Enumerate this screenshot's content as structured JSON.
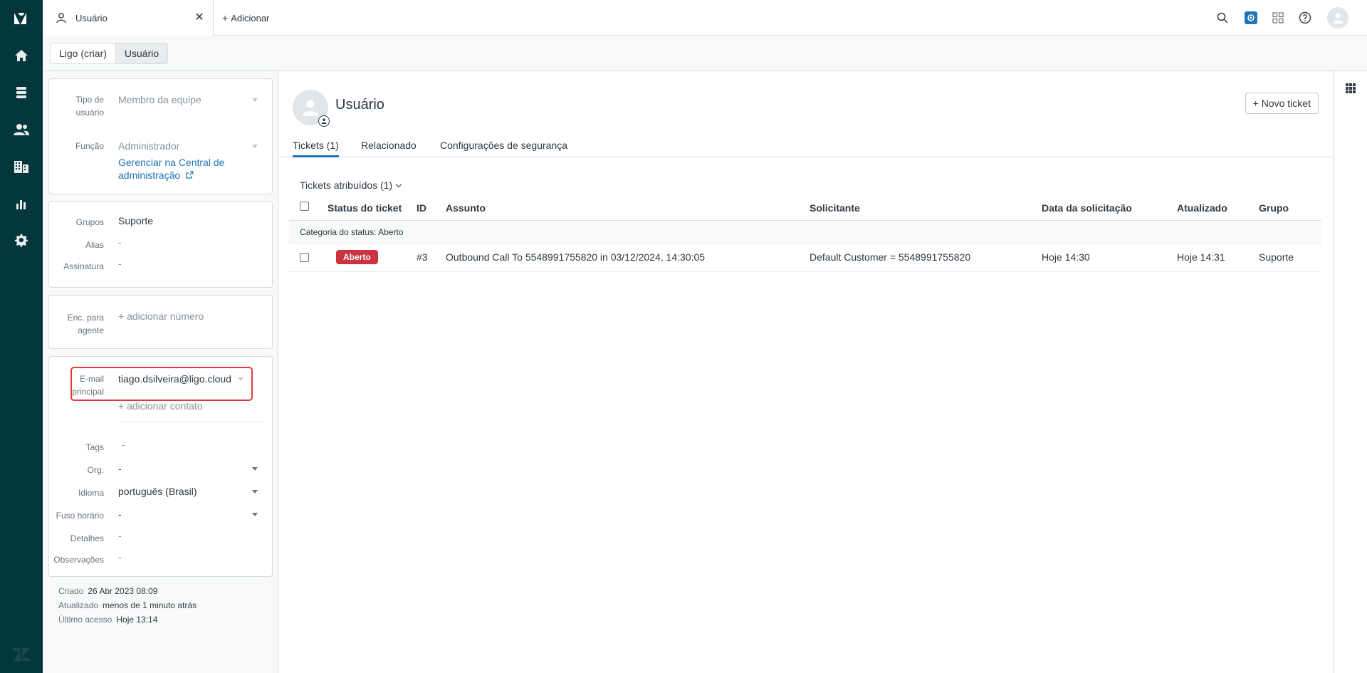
{
  "nav": {
    "items": [
      {
        "name": "home-icon"
      },
      {
        "name": "views-icon"
      },
      {
        "name": "customers-icon"
      },
      {
        "name": "organizations-icon"
      },
      {
        "name": "reporting-icon"
      },
      {
        "name": "admin-gear-icon"
      }
    ]
  },
  "topbar": {
    "tab_title": "Usuário",
    "add_label": "Adicionar",
    "add_plus": "+"
  },
  "breadcrumb": {
    "items": [
      "Ligo (criar)",
      "Usuário"
    ]
  },
  "user_card": {
    "type_label": "Tipo de usuário",
    "type_value": "Membro da equipe",
    "role_label": "Função",
    "role_value": "Administrador",
    "role_link": "Gerenciar na Central de administração"
  },
  "groups_card": {
    "groups_label": "Grupos",
    "groups_value": "Suporte",
    "alias_label": "Alias",
    "alias_value": "-",
    "signature_label": "Assinatura",
    "signature_value": "-"
  },
  "forward_card": {
    "label": "Enc. para agente",
    "add_number": "+ adicionar número"
  },
  "contact_card": {
    "email_label": "E-mail principal",
    "email_value": "tiago.dsilveira@ligo.cloud",
    "add_contact": "+ adicionar contato",
    "tags_label": "Tags",
    "tags_value": "-",
    "org_label": "Org.",
    "org_value": "-",
    "language_label": "Idioma",
    "language_value": "português (Brasil)",
    "timezone_label": "Fuso horário",
    "timezone_value": "-",
    "details_label": "Detalhes",
    "details_value": "-",
    "notes_label": "Observações",
    "notes_value": "-"
  },
  "meta": {
    "created_label": "Criado",
    "created_value": "26 Abr 2023 08:09",
    "updated_label": "Atualizado",
    "updated_value": "menos de 1 minuto atrás",
    "last_access_label": "Último acesso",
    "last_access_value": "Hoje 13:14"
  },
  "main": {
    "user_name": "Usuário",
    "new_ticket": "+ Novo ticket",
    "tabs": [
      "Tickets (1)",
      "Relacionado",
      "Configurações de segurança"
    ],
    "section_title": "Tickets atribuídos (1)",
    "columns": [
      "Status do ticket",
      "ID",
      "Assunto",
      "Solicitante",
      "Data da solicitação",
      "Atualizado",
      "Grupo"
    ],
    "group_label": "Categoria do status:",
    "group_value": "Aberto",
    "rows": [
      {
        "status": "Aberto",
        "id": "#3",
        "subject": "Outbound Call To 5548991755820 in 03/12/2024, 14:30:05",
        "requester": "Default Customer = 5548991755820",
        "requested": "Hoje 14:30",
        "updated": "Hoje 14:31",
        "group": "Suporte"
      }
    ]
  },
  "colors": {
    "nav_bg": "#03363d",
    "accent": "#1f73b7",
    "status_open": "#cc3340",
    "highlight": "#e03a3e"
  }
}
